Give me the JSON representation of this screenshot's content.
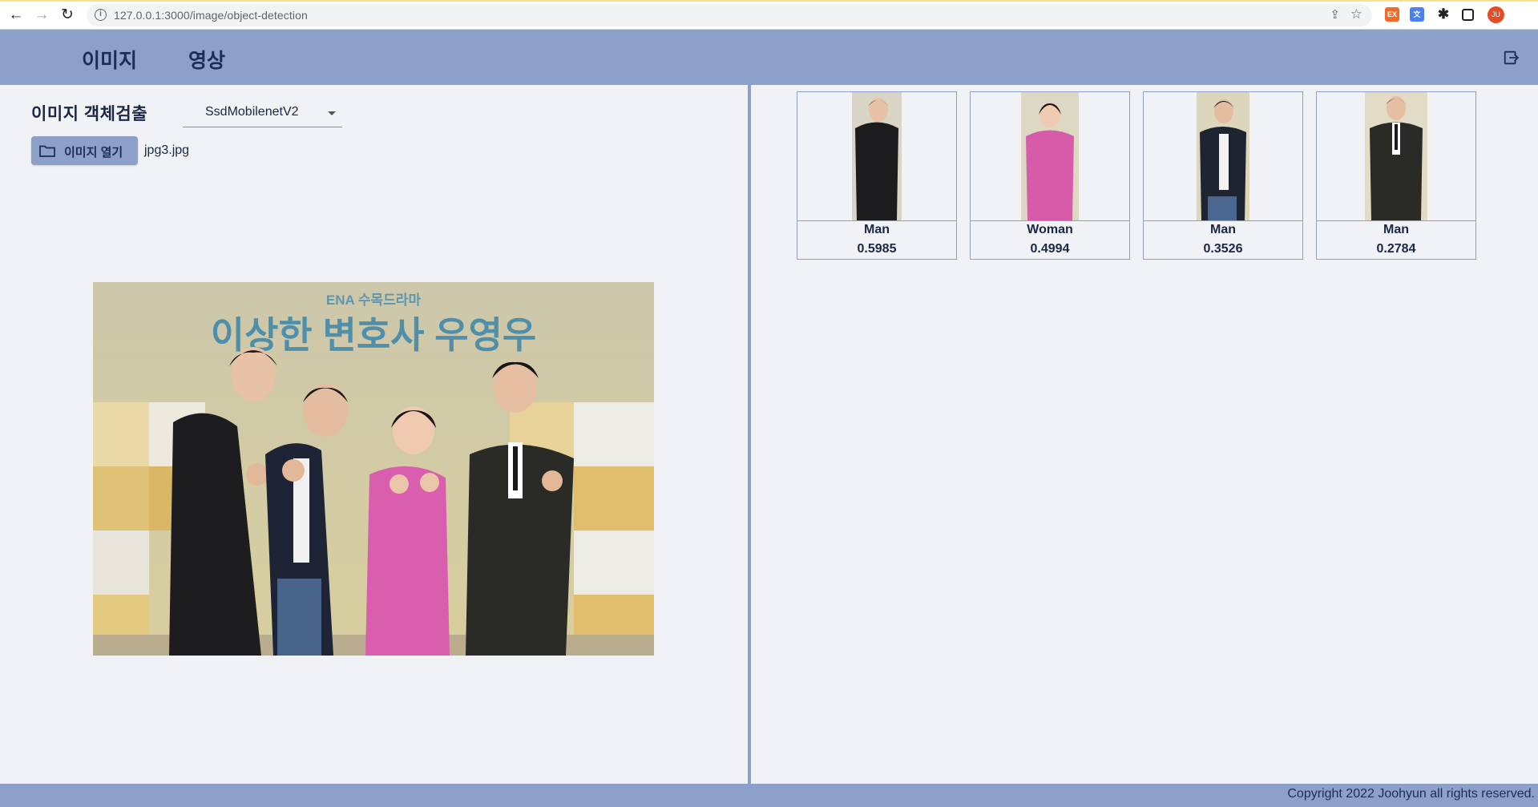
{
  "browser": {
    "url": "127.0.0.1:3000/image/object-detection",
    "profile_initials": "JU",
    "ext_1": "EX"
  },
  "header": {
    "tabs": [
      {
        "label": "이미지"
      },
      {
        "label": "영상"
      }
    ]
  },
  "panel": {
    "title": "이미지 객체검출",
    "model_selected": "SsdMobilenetV2",
    "open_button_label": "이미지 열기",
    "file_name": "jpg3.jpg"
  },
  "photo": {
    "banner_brand": "ENA 수목드라마",
    "banner_title": "이상한 변호사 우영우"
  },
  "results": [
    {
      "label": "Man",
      "score": "0.5985",
      "suit": "#1c1c1e",
      "inner": "#1c1c1e"
    },
    {
      "label": "Woman",
      "score": "0.4994",
      "suit": "#d65ca9",
      "inner": "#e070b8"
    },
    {
      "label": "Man",
      "score": "0.3526",
      "suit": "#1f2433",
      "inner": "#f2f2f2"
    },
    {
      "label": "Man",
      "score": "0.2784",
      "suit": "#2a2b27",
      "inner": "#ffffff"
    }
  ],
  "footer": {
    "copyright": "Copyright 2022 Joohyun all rights reserved."
  },
  "colors": {
    "accent": "#8ca0c9",
    "background": "#f0f2f6",
    "text": "#1c2745"
  }
}
